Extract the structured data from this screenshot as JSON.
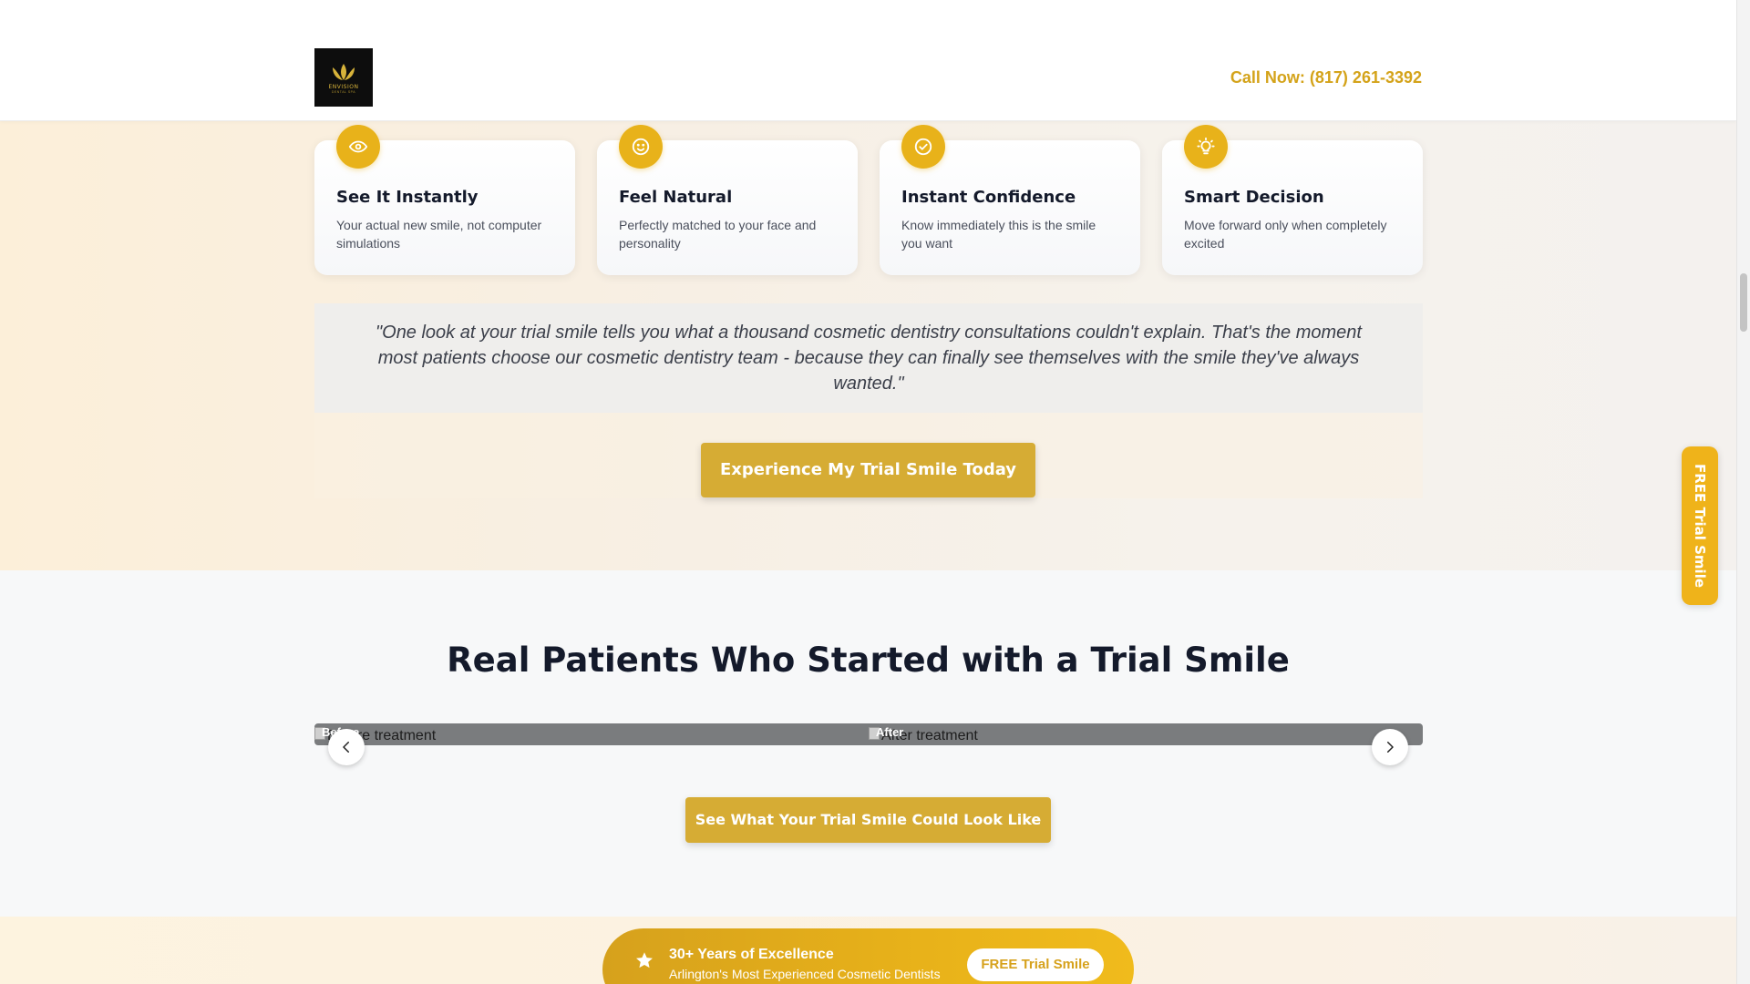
{
  "header": {
    "logo_text": "ENVISION",
    "logo_sub": "DENTAL SPA",
    "call_label": "Call Now: (817) 261-3392"
  },
  "benefits": [
    {
      "icon": "eye-icon",
      "title": "See It Instantly",
      "text": "Your actual new smile, not computer simulations"
    },
    {
      "icon": "smile-icon",
      "title": "Feel Natural",
      "text": "Perfectly matched to your face and personality"
    },
    {
      "icon": "check-circle-icon",
      "title": "Instant Confidence",
      "text": "Know immediately this is the smile you want"
    },
    {
      "icon": "lightbulb-icon",
      "title": "Smart Decision",
      "text": "Move forward only when completely excited"
    }
  ],
  "quote": "\"One look at your trial smile tells you what a thousand cosmetic dentistry consultations couldn't explain. That's the moment most patients choose our cosmetic dentistry team - because they can finally see themselves with the smile they've always wanted.\"",
  "cta_primary": "Experience My Trial Smile Today",
  "patients": {
    "heading": "Real Patients Who Started with a Trial Smile",
    "before_label": "Before",
    "before_alt": "Before treatment",
    "after_label": "After",
    "after_alt": "After treatment",
    "cta": "See What Your Trial Smile Could Look Like"
  },
  "footer_pill": {
    "title": "30+ Years of Excellence",
    "subtitle": "Arlington's Most Experienced Cosmetic Dentists",
    "button": "FREE Trial Smile"
  },
  "side_tab": "FREE Trial Smile",
  "colors": {
    "gold": "#e8b21a",
    "button_gold": "#d6ac34",
    "heading": "#141a2b",
    "call_text": "#d4a31a"
  }
}
